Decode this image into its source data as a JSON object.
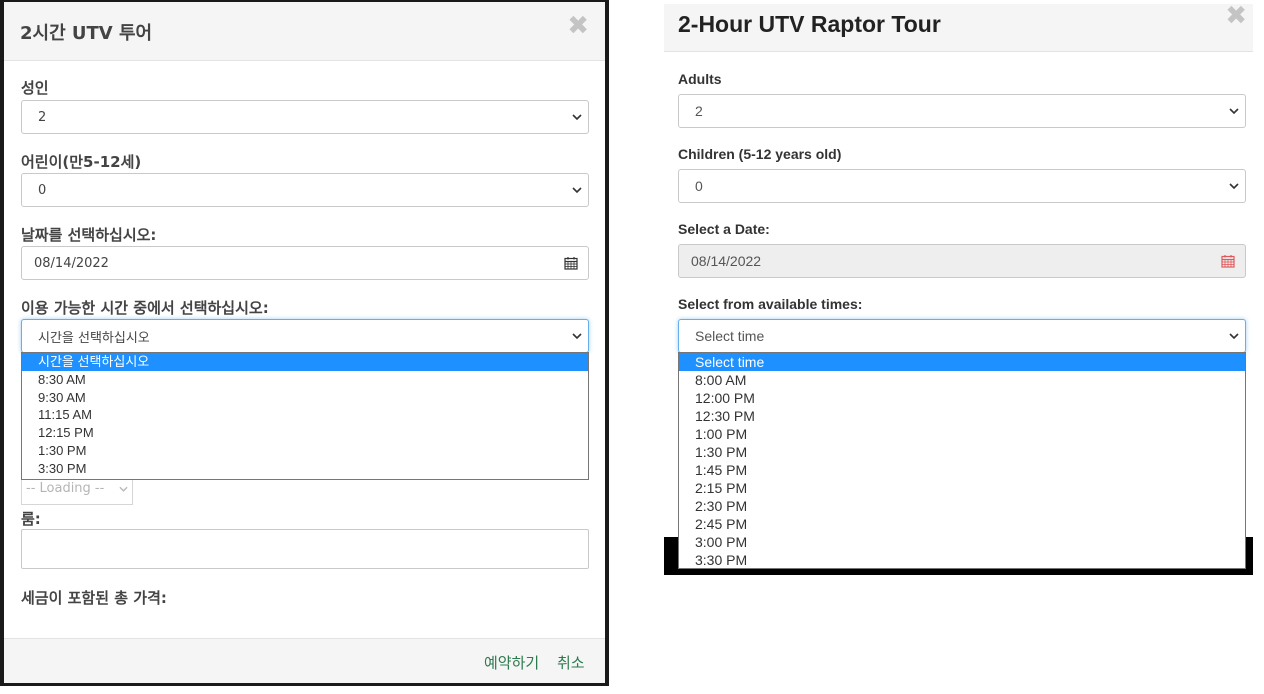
{
  "left_modal": {
    "title": "2시간 UTV 투어",
    "close_glyph": "✖",
    "adults_label": "성인",
    "adults_value": "2",
    "children_label": "어린이(만5-12세)",
    "children_value": "0",
    "date_label": "날짜를 선택하십시오:",
    "date_value": "08/14/2022",
    "time_label": "이용 가능한 시간 중에서 선택하십시오:",
    "time_selected": "시간을 선택하십시오",
    "time_options": [
      "시간을 선택하십시오",
      "8:30 AM",
      "9:30 AM",
      "11:15 AM",
      "12:15 PM",
      "1:30 PM",
      "3:30 PM"
    ],
    "loading_text": "-- Loading --",
    "room_label": "룸:",
    "total_label": "세금이 포함된 총 가격:",
    "book_button": "예약하기",
    "cancel_button": "취소"
  },
  "right_modal": {
    "title": "2-Hour UTV Raptor Tour",
    "close_glyph": "✖",
    "adults_label": "Adults",
    "adults_value": "2",
    "children_label": "Children (5-12 years old)",
    "children_value": "0",
    "date_label": "Select a Date:",
    "date_value": "08/14/2022",
    "time_label": "Select from available times:",
    "time_selected": "Select time",
    "time_options": [
      "Select time",
      "8:00 AM",
      "12:00 PM",
      "12:30 PM",
      "1:00 PM",
      "1:30 PM",
      "1:45 PM",
      "2:15 PM",
      "2:30 PM",
      "2:45 PM",
      "3:00 PM",
      "3:30 PM"
    ]
  },
  "icons": {
    "calendar": "calendar-icon",
    "chevron": "chevron-down-icon",
    "close": "close-icon"
  },
  "colors": {
    "highlight": "#1e90ff",
    "footer_link": "#2d7a4e",
    "calendar_red": "#e0595a",
    "focus_border": "#66afe9"
  }
}
